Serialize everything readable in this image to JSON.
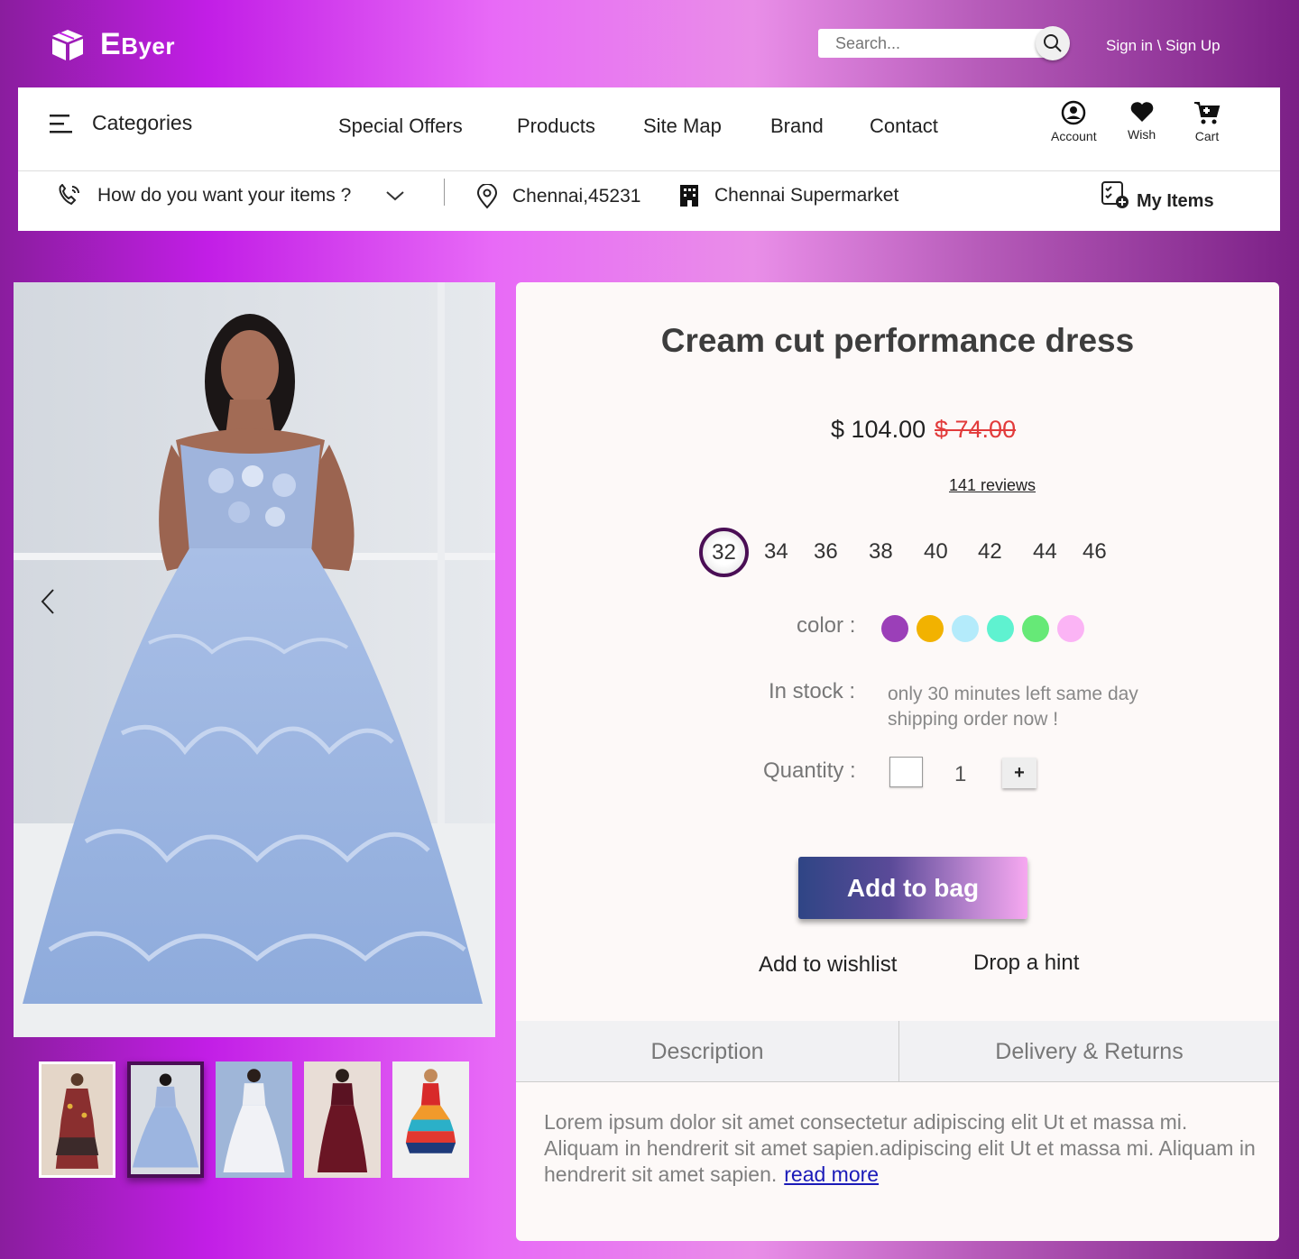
{
  "header": {
    "brand_big": "E",
    "brand_rest": "Byer",
    "search_placeholder": "Search...",
    "signin": "Sign in \\ Sign Up"
  },
  "nav": {
    "categories": "Categories",
    "links": [
      "Special Offers",
      "Products",
      "Site Map",
      "Brand",
      "Contact"
    ],
    "icons": [
      {
        "label": "Account",
        "icon": "account-icon"
      },
      {
        "label": "Wish",
        "icon": "heart-icon"
      },
      {
        "label": "Cart",
        "icon": "cart-icon"
      }
    ]
  },
  "subnav": {
    "delivery": "How do you want your items ?",
    "location": "Chennai,45231",
    "store": "Chennai Supermarket",
    "my_items": "My Items"
  },
  "product": {
    "title": "Cream cut performance dress",
    "price": "$ 104.00",
    "old_price": "$ 74.00",
    "reviews": "141 reviews",
    "sizes": [
      "32",
      "34",
      "36",
      "38",
      "40",
      "42",
      "44",
      "46"
    ],
    "selected_size": "32",
    "color_label": "color :",
    "colors": [
      "#9b3fb8",
      "#f2b200",
      "#b4ebfb",
      "#5ff2d0",
      "#66e977",
      "#fbb4f5"
    ],
    "stock_label": "In stock :",
    "stock_text": "only 30 minutes left same day shipping order now !",
    "quantity_label": "Quantity :",
    "quantity": "1",
    "plus": "+",
    "add_to_bag": "Add to bag",
    "add_to_wishlist": "Add to wishlist",
    "drop_hint": "Drop a hint"
  },
  "tabs": [
    "Description",
    "Delivery & Returns"
  ],
  "description": {
    "text": "Lorem ipsum dolor sit amet consectetur adipiscing elit Ut et massa mi. Aliquam in hendrerit sit amet sapien.adipiscing elit Ut et massa mi. Aliquam in hendrerit sit amet sapien.",
    "read_more": "read more"
  },
  "colors": {
    "accent_dark": "#4a0e55",
    "old_price": "#e23b3b"
  }
}
